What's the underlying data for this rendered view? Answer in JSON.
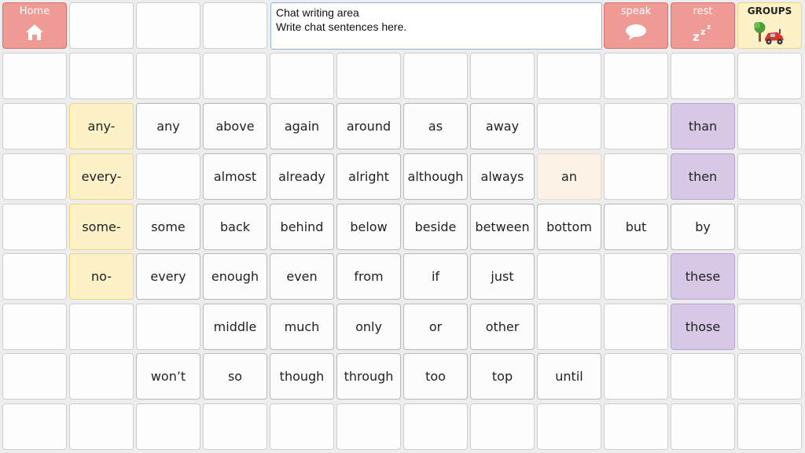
{
  "controls": {
    "home": {
      "label": "Home",
      "icon": "home-icon"
    },
    "speak": {
      "label": "speak",
      "icon": "speech-bubble-icon"
    },
    "rest": {
      "label": "rest",
      "icon": "sleep-zzz-icon"
    },
    "groups": {
      "label": "GROUPS",
      "icon": "tree-and-car-icon"
    }
  },
  "chat": {
    "title": "Chat writing area",
    "placeholder": "Write chat sentences here."
  },
  "colors": {
    "control": "#ef9a94",
    "prefix": "#fdf1c7",
    "article": "#fdf2e6",
    "pronoun": "#d6c8e6",
    "word": "#fcfcfc",
    "blank": "#fdfdfd",
    "chat_border": "#8fb4d8"
  },
  "rows": [
    [
      {
        "type": "control",
        "key": "home"
      },
      {
        "type": "blank"
      },
      {
        "type": "blank"
      },
      {
        "type": "blank"
      },
      {
        "type": "chat"
      },
      {
        "type": "chat"
      },
      {
        "type": "chat"
      },
      {
        "type": "chat"
      },
      {
        "type": "chat"
      },
      {
        "type": "control",
        "key": "speak"
      },
      {
        "type": "control",
        "key": "rest"
      },
      {
        "type": "groups",
        "key": "groups"
      }
    ],
    [
      {
        "type": "blank"
      },
      {
        "type": "blank"
      },
      {
        "type": "blank"
      },
      {
        "type": "blank"
      },
      {
        "type": "blank"
      },
      {
        "type": "blank"
      },
      {
        "type": "blank"
      },
      {
        "type": "blank"
      },
      {
        "type": "blank"
      },
      {
        "type": "blank"
      },
      {
        "type": "blank"
      },
      {
        "type": "blank"
      }
    ],
    [
      {
        "type": "blank"
      },
      {
        "type": "prefix",
        "text": "any-"
      },
      {
        "type": "word",
        "text": "any"
      },
      {
        "type": "word",
        "text": "above"
      },
      {
        "type": "word",
        "text": "again"
      },
      {
        "type": "word",
        "text": "around"
      },
      {
        "type": "word",
        "text": "as"
      },
      {
        "type": "word",
        "text": "away"
      },
      {
        "type": "blank"
      },
      {
        "type": "blank"
      },
      {
        "type": "pronoun",
        "text": "than"
      },
      {
        "type": "blank"
      }
    ],
    [
      {
        "type": "blank"
      },
      {
        "type": "prefix",
        "text": "every-"
      },
      {
        "type": "blank"
      },
      {
        "type": "word",
        "text": "almost"
      },
      {
        "type": "word",
        "text": "already"
      },
      {
        "type": "word",
        "text": "alright"
      },
      {
        "type": "word",
        "text": "although"
      },
      {
        "type": "word",
        "text": "always"
      },
      {
        "type": "article",
        "text": "an"
      },
      {
        "type": "blank"
      },
      {
        "type": "pronoun",
        "text": "then"
      },
      {
        "type": "blank"
      }
    ],
    [
      {
        "type": "blank"
      },
      {
        "type": "prefix",
        "text": "some-"
      },
      {
        "type": "word",
        "text": "some"
      },
      {
        "type": "word",
        "text": "back"
      },
      {
        "type": "word",
        "text": "behind"
      },
      {
        "type": "word",
        "text": "below"
      },
      {
        "type": "word",
        "text": "beside"
      },
      {
        "type": "word",
        "text": "between"
      },
      {
        "type": "word",
        "text": "bottom"
      },
      {
        "type": "word",
        "text": "but"
      },
      {
        "type": "word",
        "text": "by"
      },
      {
        "type": "blank"
      }
    ],
    [
      {
        "type": "blank"
      },
      {
        "type": "prefix",
        "text": "no-"
      },
      {
        "type": "word",
        "text": "every"
      },
      {
        "type": "word",
        "text": "enough"
      },
      {
        "type": "word",
        "text": "even"
      },
      {
        "type": "word",
        "text": "from"
      },
      {
        "type": "word",
        "text": "if"
      },
      {
        "type": "word",
        "text": "just"
      },
      {
        "type": "blank"
      },
      {
        "type": "blank"
      },
      {
        "type": "pronoun",
        "text": "these"
      },
      {
        "type": "blank"
      }
    ],
    [
      {
        "type": "blank"
      },
      {
        "type": "blank"
      },
      {
        "type": "blank"
      },
      {
        "type": "word",
        "text": "middle"
      },
      {
        "type": "word",
        "text": "much"
      },
      {
        "type": "word",
        "text": "only"
      },
      {
        "type": "word",
        "text": "or"
      },
      {
        "type": "word",
        "text": "other"
      },
      {
        "type": "blank"
      },
      {
        "type": "blank"
      },
      {
        "type": "pronoun",
        "text": "those"
      },
      {
        "type": "blank"
      }
    ],
    [
      {
        "type": "blank"
      },
      {
        "type": "blank"
      },
      {
        "type": "word",
        "text": "won’t"
      },
      {
        "type": "word",
        "text": "so"
      },
      {
        "type": "word",
        "text": "though"
      },
      {
        "type": "word",
        "text": "through"
      },
      {
        "type": "word",
        "text": "too"
      },
      {
        "type": "word",
        "text": "top"
      },
      {
        "type": "word",
        "text": "until"
      },
      {
        "type": "blank"
      },
      {
        "type": "blank"
      },
      {
        "type": "blank"
      }
    ],
    [
      {
        "type": "blank"
      },
      {
        "type": "blank"
      },
      {
        "type": "blank"
      },
      {
        "type": "blank"
      },
      {
        "type": "blank"
      },
      {
        "type": "blank"
      },
      {
        "type": "blank"
      },
      {
        "type": "blank"
      },
      {
        "type": "blank"
      },
      {
        "type": "blank"
      },
      {
        "type": "blank"
      },
      {
        "type": "blank"
      }
    ]
  ]
}
